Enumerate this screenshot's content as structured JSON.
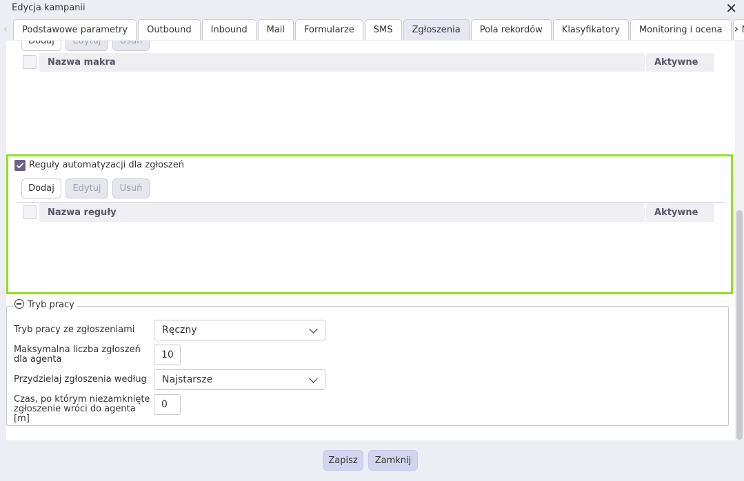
{
  "window": {
    "title": "Edycja kampanii"
  },
  "tabs": [
    {
      "label": "Podstawowe parametry"
    },
    {
      "label": "Outbound"
    },
    {
      "label": "Inbound"
    },
    {
      "label": "Mail"
    },
    {
      "label": "Formularze"
    },
    {
      "label": "SMS"
    },
    {
      "label": "Zgłoszenia",
      "active": true
    },
    {
      "label": "Pola rekordów"
    },
    {
      "label": "Klasyfikatory"
    },
    {
      "label": "Monitoring i ocena"
    },
    {
      "label": "Nadzo"
    }
  ],
  "macros": {
    "buttons": {
      "add": "Dodaj",
      "edit": "Edytuj",
      "delete": "Usuń"
    },
    "columns": {
      "name": "Nazwa makra",
      "active": "Aktywne"
    }
  },
  "rules": {
    "checkbox_label": "Reguły automatyzacji dla zgłoszeń",
    "checked": true,
    "buttons": {
      "add": "Dodaj",
      "edit": "Edytuj",
      "delete": "Usuń"
    },
    "columns": {
      "name": "Nazwa reguły",
      "active": "Aktywne"
    }
  },
  "work_mode": {
    "legend": "Tryb pracy",
    "fields": {
      "mode_label": "Tryb pracy ze zgłoszeniami",
      "mode_value": "Ręczny",
      "max_label": "Maksymalna liczba zgłoszeń dla agenta",
      "max_value": "10",
      "assign_label": "Przydzielaj zgłoszenia według",
      "assign_value": "Najstarsze",
      "time_label": "Czas, po którym niezamknięte zgłoszenie wróci do agenta [m]",
      "time_value": "0"
    }
  },
  "footer": {
    "save": "Zapisz",
    "close": "Zamknij"
  },
  "colors": {
    "highlight": "#8fe022",
    "accent": "#6b6085",
    "footer_button": "#d3d4ee"
  }
}
